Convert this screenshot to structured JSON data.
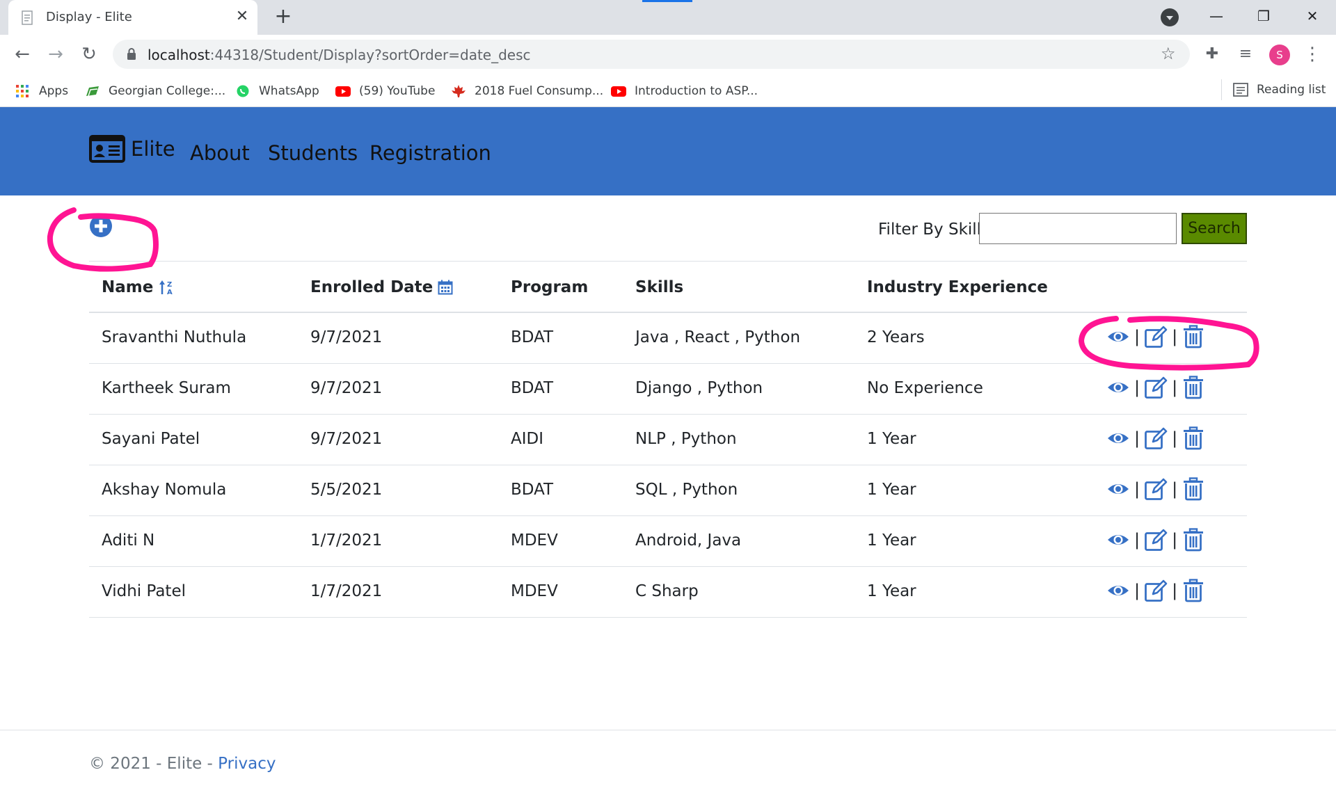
{
  "browser": {
    "tab_title": "Display - Elite",
    "tab_close": "✕",
    "new_tab": "+",
    "url_host": "localhost",
    "url_path": ":44318/Student/Display?sortOrder=date_desc",
    "profile_initial": "S",
    "bookmarks": [
      {
        "label": "Apps",
        "icon": "apps-grid-icon"
      },
      {
        "label": "Georgian College:...",
        "icon": "georgian-icon"
      },
      {
        "label": "WhatsApp",
        "icon": "whatsapp-icon"
      },
      {
        "label": "(59) YouTube",
        "icon": "youtube-icon"
      },
      {
        "label": "2018 Fuel Consump...",
        "icon": "maple-leaf-icon"
      },
      {
        "label": "Introduction to ASP...",
        "icon": "youtube-icon"
      }
    ],
    "reading_list": "Reading list"
  },
  "navbar": {
    "brand": "Elite",
    "links": [
      "About",
      "Students",
      "Registration"
    ],
    "color": "#3670c5"
  },
  "filter": {
    "label": "Filter By Skill:",
    "value": "",
    "button": "Search"
  },
  "table": {
    "headers": [
      "Name",
      "Enrolled Date",
      "Program",
      "Skills",
      "Industry Experience"
    ],
    "rows": [
      {
        "name": "Sravanthi Nuthula",
        "date": "9/7/2021",
        "program": "BDAT",
        "skills": "Java , React , Python",
        "experience": "2 Years"
      },
      {
        "name": "Kartheek Suram",
        "date": "9/7/2021",
        "program": "BDAT",
        "skills": "Django , Python",
        "experience": "No Experience"
      },
      {
        "name": "Sayani Patel",
        "date": "9/7/2021",
        "program": "AIDI",
        "skills": "NLP , Python",
        "experience": "1 Year"
      },
      {
        "name": "Akshay Nomula",
        "date": "5/5/2021",
        "program": "BDAT",
        "skills": "SQL , Python",
        "experience": "1 Year"
      },
      {
        "name": "Aditi N",
        "date": "1/7/2021",
        "program": "MDEV",
        "skills": "Android, Java",
        "experience": "1 Year"
      },
      {
        "name": "Vidhi Patel",
        "date": "1/7/2021",
        "program": "MDEV",
        "skills": "C Sharp",
        "experience": "1 Year"
      }
    ],
    "action_separator": "|"
  },
  "footer": {
    "text": "© 2021 - Elite - ",
    "link": "Privacy"
  },
  "colors": {
    "accent": "#3670c5",
    "search_button": "#5a8a00",
    "annotation": "#ff1493"
  }
}
